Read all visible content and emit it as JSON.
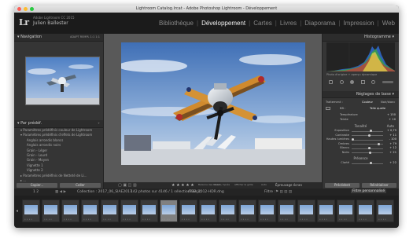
{
  "window": {
    "title": "Lightroom Catalog.lrcat - Adobe Photoshop Lightroom - Développement",
    "identity_version": "Adobe Lightroom CC 2015",
    "identity_user": "Julien Ballester",
    "lights": [
      "#fc5f57",
      "#fdbc2e",
      "#28c940"
    ]
  },
  "modules": [
    "Bibliothèque",
    "Développement",
    "Cartes",
    "Livres",
    "Diaporama",
    "Impression",
    "Web"
  ],
  "active_module": "Développement",
  "left_panel": {
    "navigator_title": "Navigation",
    "navigator_options": "ADAPT  REMPL  1:1  1:1",
    "presets_title": "Par prédéf.",
    "presets": [
      "▾ Paramètres prédéfinis couleur de Lightroom",
      "▾ Paramètres prédéfinis d'effets de Lightroom",
      "Anglais arrondis blancs",
      "Anglais arrondis noirs",
      "Grain - Léger",
      "Grain - Lourd",
      "Grain - Moyen",
      "Vignette 1",
      "Vignette 2",
      "▸ Paramètres prédéfinis de Netteté de Li...",
      "▸ ..."
    ],
    "copy_button": "Copier...",
    "paste_button": "Coller"
  },
  "right_panel": {
    "histogram_title": "Histogramme",
    "histogram_caption": "Photo d'origine + aperçu dynamique",
    "basic_title": "Réglages de base",
    "treatment_label": "Traitement :",
    "treatment_color": "Couleur",
    "treatment_bw": "Noir/blanc",
    "wb_label": "BB :",
    "wb_value": "Telle quelle",
    "temp_label": "Température",
    "temp_value": "+ 150",
    "tint_label": "Teinte",
    "tint_value": "+ 10",
    "tone_label": "Tonalité",
    "tone_auto": "Auto",
    "presence_label": "Présence",
    "previous_button": "Précédent",
    "reset_button": "Réinitialiser"
  },
  "sliders": [
    {
      "name": "Exposition",
      "value": "+ 0,75",
      "pos": 0.62
    },
    {
      "name": "Contraste",
      "value": "+ 11",
      "pos": 0.56
    },
    {
      "name": "Hautes lumières",
      "value": "- 100",
      "pos": 0.0
    },
    {
      "name": "Ombres",
      "value": "+ 79",
      "pos": 0.9
    },
    {
      "name": "Blancs",
      "value": "+ 12",
      "pos": 0.56
    },
    {
      "name": "Noirs",
      "value": "+ 21",
      "pos": 0.6
    }
  ],
  "presence_slider": {
    "name": "Clarté",
    "value": "+ 22",
    "pos": 0.61
  },
  "toolbar": {
    "flags": "▢ ▣ ◫ ▥",
    "stars": "★ ★ ★ ★ ★",
    "wb_label": "Balance des blancs",
    "before_after": "Avant / Après",
    "show_grid": "Afficher la grille",
    "auto_label": "Auto",
    "softproof": "Épreuvage écran"
  },
  "filmbar": {
    "pages": "1  2",
    "collection": "Collection : 2017_06_SIAE2017",
    "count": "142 photos sur 4146 / 1 sélectionnée(s)",
    "file": "/TD2_2012-HDR.dng",
    "filter_label": "Filtre :",
    "filter_value": "Filtre personnalisé"
  },
  "filmstrip_count": 19,
  "filmstrip_selected": 7
}
